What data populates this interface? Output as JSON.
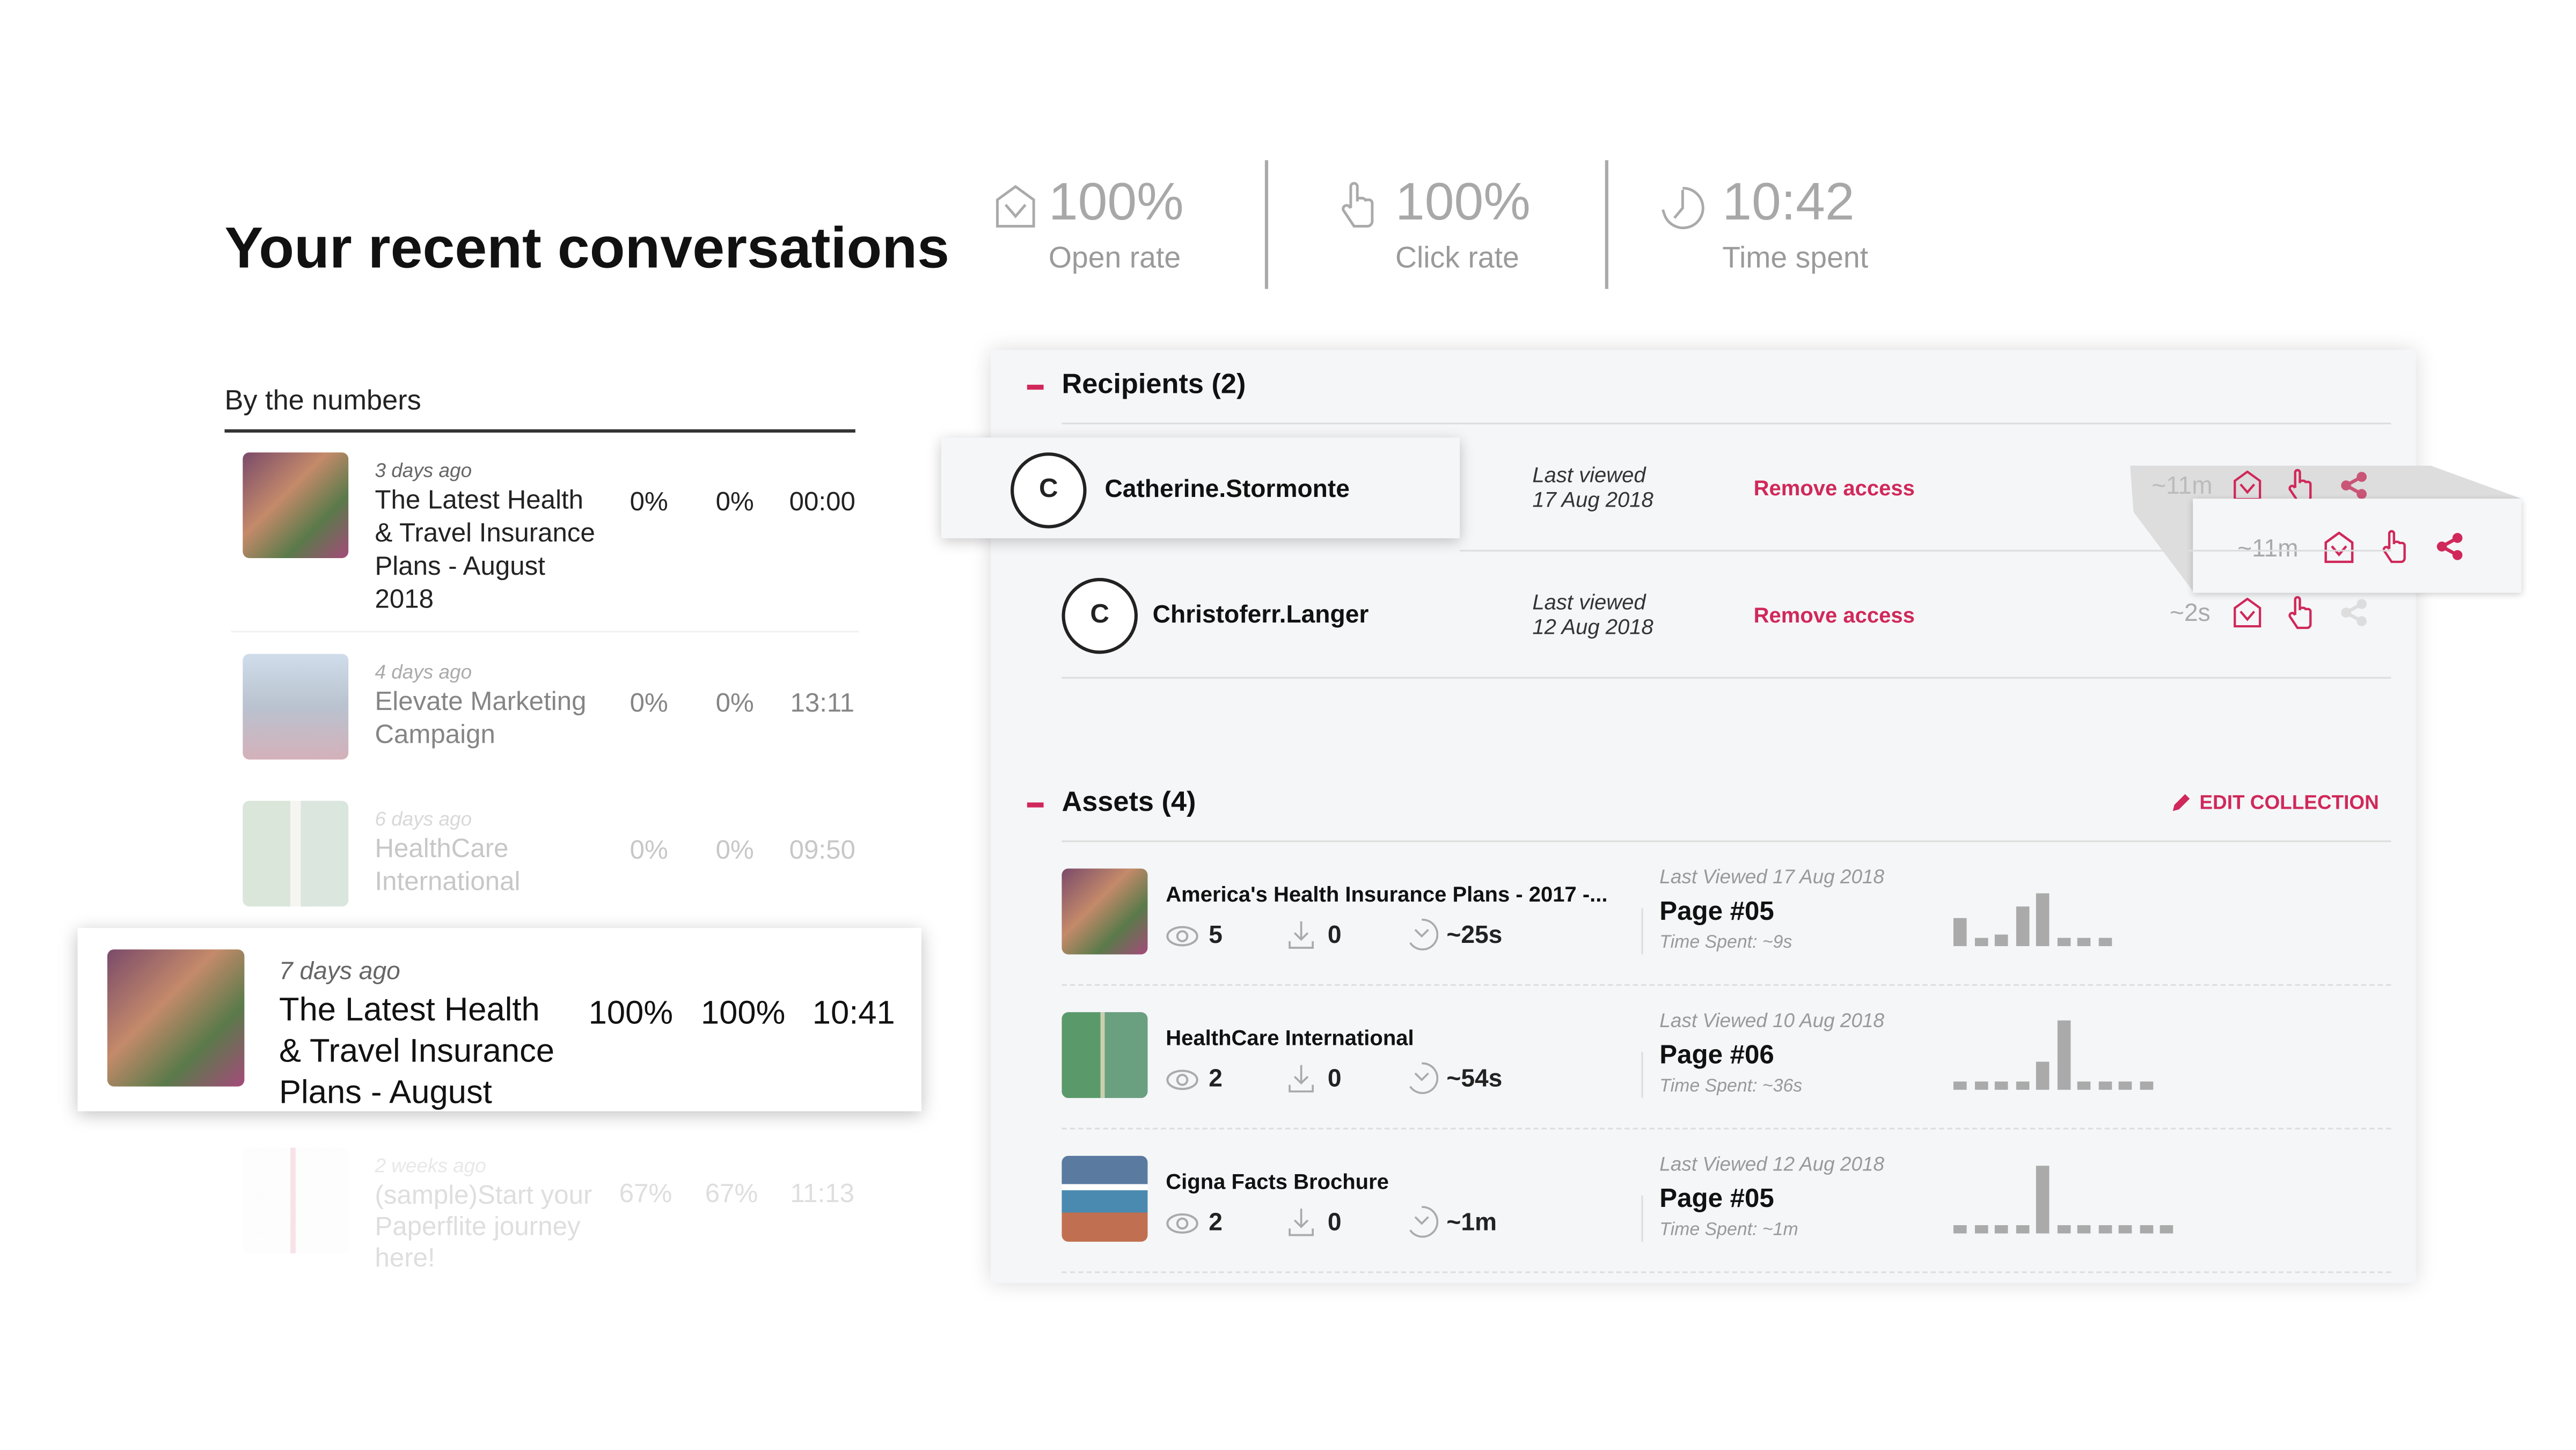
{
  "header": {
    "title": "Your recent conversations",
    "subtitle": "By the numbers"
  },
  "conversations": [
    {
      "date": "3 days ago",
      "title_lines": [
        "The Latest Health",
        "& Travel Insurance",
        "Plans - August",
        "2018"
      ],
      "open": "0%",
      "click": "0%",
      "time": "00:00"
    },
    {
      "date": "4 days ago",
      "title_lines": [
        "Elevate Marketing",
        "Campaign"
      ],
      "open": "0%",
      "click": "0%",
      "time": "13:11"
    },
    {
      "date": "6 days ago",
      "title_lines": [
        "HealthCare",
        "International"
      ],
      "open": "0%",
      "click": "0%",
      "time": "09:50"
    },
    {
      "date": "7 days ago",
      "title_lines": [
        "The Latest Health",
        "& Travel Insurance",
        "Plans - August"
      ],
      "open": "100%",
      "click": "100%",
      "time": "10:41"
    },
    {
      "date": "2 weeks ago",
      "title_lines": [
        "(sample)Start your",
        "Paperflite journey",
        "here!"
      ],
      "open": "67%",
      "click": "67%",
      "time": "11:13"
    }
  ],
  "stats": [
    {
      "icon": "envelope-open-icon",
      "value": "100%",
      "label": "Open rate"
    },
    {
      "icon": "hand-pointer-icon",
      "value": "100%",
      "label": "Click rate"
    },
    {
      "icon": "clock-icon",
      "value": "10:42",
      "label": "Time spent"
    }
  ],
  "recipients": {
    "heading": "Recipients (2)",
    "items": [
      {
        "initial": "C",
        "name": "Catherine.Stormonte",
        "last_viewed_label": "Last viewed",
        "last_viewed": "17 Aug 2018",
        "action": "Remove access",
        "duration": "~11m",
        "shared": true
      },
      {
        "initial": "C",
        "name": "Christoferr.Langer",
        "last_viewed_label": "Last viewed",
        "last_viewed": "12 Aug 2018",
        "action": "Remove access",
        "duration": "~2s",
        "shared": false
      }
    ],
    "popup": {
      "duration": "~11m"
    }
  },
  "assets": {
    "heading": "Assets (4)",
    "edit_label": "EDIT COLLECTION",
    "items": [
      {
        "title": "America's Health Insurance Plans - 2017 -...",
        "views": "5",
        "downloads": "0",
        "time": "~25s",
        "last_viewed": "Last Viewed 17 Aug 2018",
        "page": "Page #05",
        "time_spent": "Time Spent: ~9s",
        "page_time_bars": [
          17,
          5,
          7,
          24,
          32,
          5,
          5,
          5
        ]
      },
      {
        "title": "HealthCare International",
        "views": "2",
        "downloads": "0",
        "time": "~54s",
        "last_viewed": "Last Viewed 10 Aug 2018",
        "page": "Page #06",
        "time_spent": "Time Spent: ~36s",
        "page_time_bars": [
          5,
          5,
          5,
          5,
          17,
          42,
          5,
          5,
          5,
          5
        ]
      },
      {
        "title": "Cigna Facts Brochure",
        "views": "2",
        "downloads": "0",
        "time": "~1m",
        "last_viewed": "Last Viewed 12 Aug 2018",
        "page": "Page #05",
        "time_spent": "Time Spent: ~1m",
        "page_time_bars": [
          5,
          5,
          5,
          5,
          41,
          5,
          5,
          5,
          5,
          5,
          5
        ]
      }
    ]
  },
  "colors": {
    "accent": "#d0285a",
    "panel_bg": "#f5f6f8",
    "muted": "#aaaaaa"
  }
}
